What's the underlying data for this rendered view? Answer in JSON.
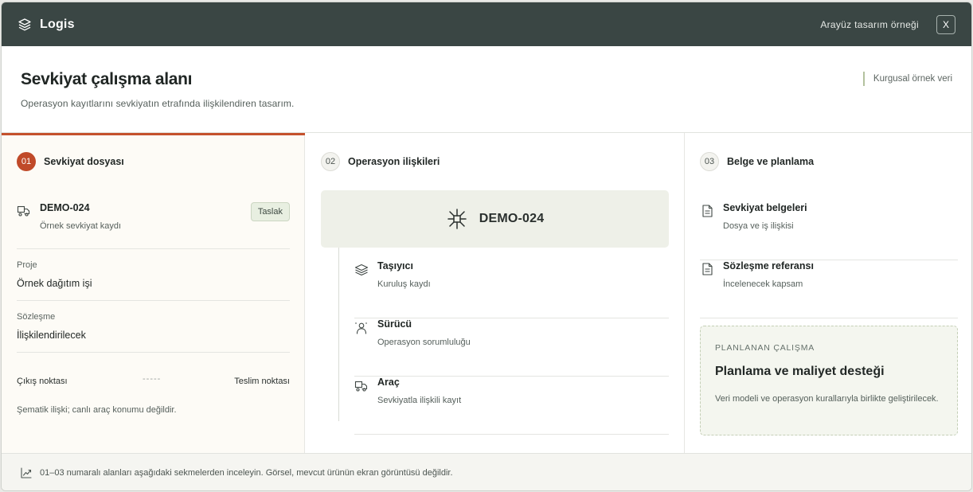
{
  "topbar": {
    "brand": "Logis",
    "note": "Arayüz tasarım örneği",
    "close_label": "X"
  },
  "header": {
    "title": "Sevkiyat çalışma alanı",
    "subtitle": "Operasyon kayıtlarını sevkiyatın etrafında ilişkilendiren tasarım.",
    "badge": "Kurgusal örnek veri"
  },
  "col1": {
    "step_number": "01",
    "step_title": "Sevkiyat dosyası",
    "shipment_id": "DEMO-024",
    "shipment_sub": "Örnek sevkiyat kaydı",
    "status_badge": "Taslak",
    "project_label": "Proje",
    "project_value": "Örnek dağıtım işi",
    "contract_label": "Sözleşme",
    "contract_value": "İlişkilendirilecek",
    "route_start": "Çıkış noktası",
    "route_dash": "-----",
    "route_end": "Teslim noktası",
    "route_note": "Şematik ilişki; canlı araç konumu değildir."
  },
  "col2": {
    "step_number": "02",
    "step_title": "Operasyon ilişkileri",
    "hub_label": "DEMO-024",
    "relations": [
      {
        "title": "Taşıyıcı",
        "sub": "Kuruluş kaydı",
        "icon": "layers-icon"
      },
      {
        "title": "Sürücü",
        "sub": "Operasyon sorumluluğu",
        "icon": "driver-icon"
      },
      {
        "title": "Araç",
        "sub": "Sevkiyatla ilişkili kayıt",
        "icon": "truck-icon"
      }
    ]
  },
  "col3": {
    "step_number": "03",
    "step_title": "Belge ve planlama",
    "docs": [
      {
        "title": "Sevkiyat belgeleri",
        "sub": "Dosya ve iş ilişkisi",
        "icon": "document-icon"
      },
      {
        "title": "Sözleşme referansı",
        "sub": "İncelenecek kapsam",
        "icon": "document-icon"
      }
    ],
    "plan_kicker": "PLANLANAN ÇALIŞMA",
    "plan_title": "Planlama ve maliyet desteği",
    "plan_desc": "Veri modeli ve operasyon kurallarıyla birlikte geliştirilecek."
  },
  "footer": {
    "text": "01–03 numaralı alanları aşağıdaki sekmelerden inceleyin. Görsel, mevcut ürünün ekran görüntüsü değildir.",
    "icon": "trend-chart-icon"
  },
  "colors": {
    "topbar_bg": "#3a4644",
    "accent": "#c04a29",
    "hub_bg": "#eef0e8",
    "plan_card_bg": "#f4f6ef"
  }
}
